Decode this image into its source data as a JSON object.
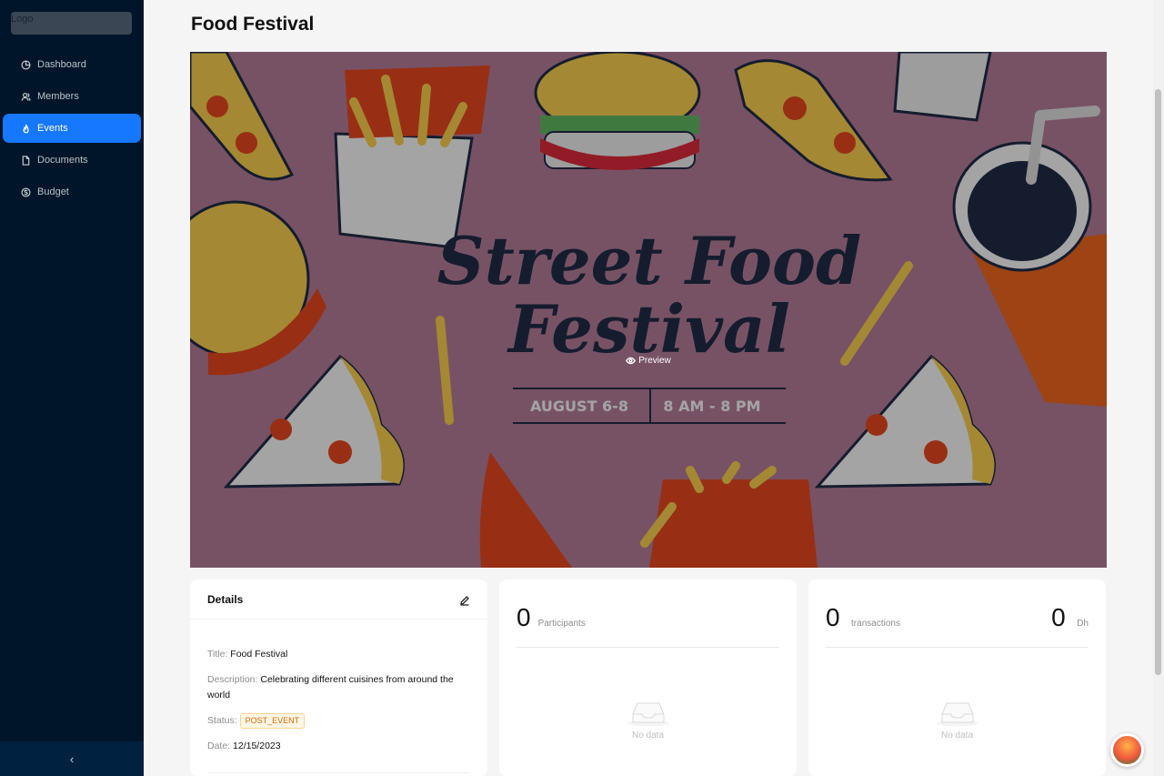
{
  "sidebar": {
    "logo": "Logo",
    "items": [
      {
        "label": "Dashboard",
        "icon": "pie-chart-icon"
      },
      {
        "label": "Members",
        "icon": "team-icon"
      },
      {
        "label": "Events",
        "icon": "fire-icon",
        "active": true
      },
      {
        "label": "Documents",
        "icon": "file-icon"
      },
      {
        "label": "Budget",
        "icon": "dollar-icon"
      }
    ],
    "collapse_icon": "chevron-left-icon"
  },
  "page": {
    "title": "Food Festival"
  },
  "banner": {
    "preview_label": "Preview",
    "poster": {
      "line1": "Street Food",
      "line2": "Festival",
      "dates": "AUGUST 6-8",
      "hours": "8 AM - 8 PM"
    }
  },
  "details": {
    "header": "Details",
    "title_label": "Title:",
    "title_value": "Food Festival",
    "description_label": "Description:",
    "description_value": "Celebrating different cuisines from around the world",
    "status_label": "Status:",
    "status_value": "POST_EVENT",
    "date_label": "Date:",
    "date_value": "12/15/2023"
  },
  "participants": {
    "count": "0",
    "label": "Participants",
    "empty_text": "No data"
  },
  "transactions": {
    "count": "0",
    "label": "transactions",
    "amount": "0",
    "currency": "Dh",
    "empty_text": "No data"
  },
  "colors": {
    "sidebar_bg": "#001529",
    "accent": "#1677ff",
    "banner_bg": "#8a5673",
    "status_tag": "#d46b08"
  }
}
